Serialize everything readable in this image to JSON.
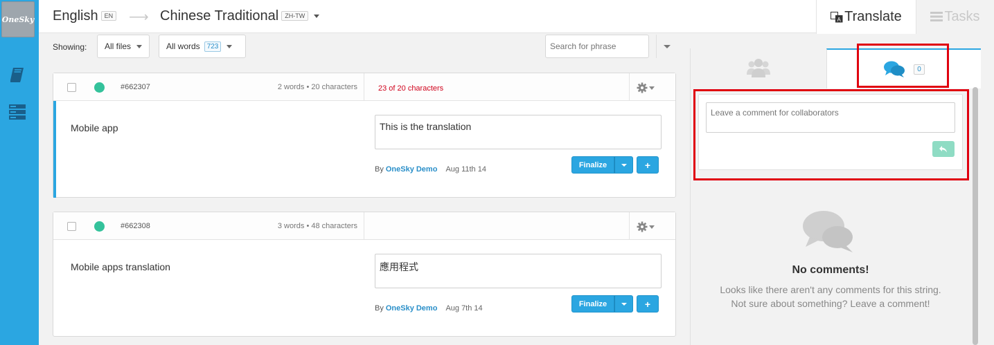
{
  "sidebar": {
    "logo_text": "OneSky",
    "items": [
      {
        "icon": "book-icon"
      },
      {
        "icon": "server-icon"
      }
    ]
  },
  "header": {
    "source_language": "English",
    "source_code": "EN",
    "target_language": "Chinese Traditional",
    "target_code": "ZH-TW"
  },
  "tabs": {
    "translate_label": "Translate",
    "tasks_label": "Tasks"
  },
  "filters": {
    "showing_label": "Showing:",
    "files_label": "All files",
    "words_label": "All words",
    "words_count": "723",
    "search_placeholder": "Search for phrase"
  },
  "strings": [
    {
      "id": "#662307",
      "meta": "2 words • 20 characters",
      "char_warning": "23 of 20 characters",
      "source": "Mobile app",
      "translation": "This is the translation",
      "by_label": "By",
      "author": "OneSky Demo",
      "date": "Aug 11th 14",
      "finalize_label": "Finalize",
      "plus_label": "+"
    },
    {
      "id": "#662308",
      "meta": "3 words • 48 characters",
      "char_warning": "",
      "source": "Mobile apps translation",
      "translation": "應用程式",
      "by_label": "By",
      "author": "OneSky Demo",
      "date": "Aug 7th 14",
      "finalize_label": "Finalize",
      "plus_label": "+"
    }
  ],
  "comments_panel": {
    "comment_count": "0",
    "input_placeholder": "Leave a comment for collaborators",
    "empty_title": "No comments!",
    "empty_text": "Looks like there aren't any comments for this string. Not sure about something? Leave a comment!"
  },
  "colors": {
    "accent": "#2ba6e1",
    "status_dot": "#34c29b",
    "warning": "#d0021b",
    "highlight": "#e0000f"
  }
}
